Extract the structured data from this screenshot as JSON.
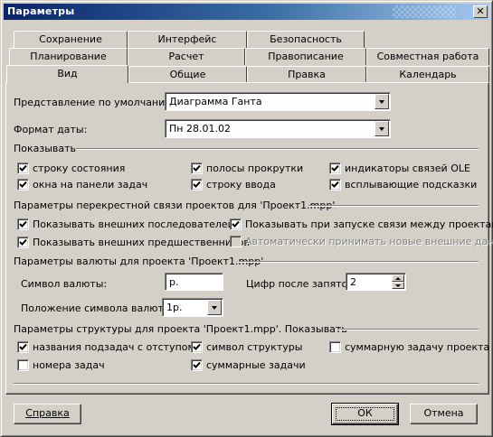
{
  "window": {
    "title": "Параметры",
    "close_glyph": "✕"
  },
  "tabs": {
    "row1": [
      "Сохранение",
      "Интерфейс",
      "Безопасность"
    ],
    "row2": [
      "Планирование",
      "Расчет",
      "Правописание",
      "Совместная работа"
    ],
    "row3": [
      "Вид",
      "Общие",
      "Правка",
      "Календарь"
    ],
    "active": "Вид"
  },
  "view": {
    "default_view_label": "Представление по умолчанию:",
    "default_view_value": "Диаграмма Ганта",
    "date_format_label": "Формат даты:",
    "date_format_value": "Пн 28.01.02"
  },
  "show": {
    "title": "Показывать",
    "items": [
      {
        "label": "строку состояния",
        "checked": true
      },
      {
        "label": "окна на панели задач",
        "checked": true
      },
      {
        "label": "полосы прокрутки",
        "checked": true
      },
      {
        "label": "строку ввода",
        "checked": true
      },
      {
        "label": "индикаторы связей OLE",
        "checked": true
      },
      {
        "label": "всплывающие подсказки",
        "checked": true
      }
    ]
  },
  "crosslink": {
    "title": "Параметры перекрестной связи проектов для 'Проект1.mpp'",
    "items": [
      {
        "label": "Показывать внешних последователей",
        "checked": true,
        "enabled": true
      },
      {
        "label": "Показывать внешних предшественников",
        "checked": true,
        "enabled": true
      },
      {
        "label": "Показывать при запуске связи между проектами",
        "checked": true,
        "enabled": true
      },
      {
        "label": "Автоматически принимать новые внешние данные",
        "checked": false,
        "enabled": false
      }
    ]
  },
  "currency": {
    "title": "Параметры валюты для проекта 'Проект1.mpp'",
    "symbol_label": "Символ валюты:",
    "symbol_value": "р.",
    "decimals_label": "Цифр после запятой:",
    "decimals_value": "2",
    "placement_label": "Положение символа валюты:",
    "placement_value": "1р."
  },
  "outline": {
    "title": "Параметры структуры для проекта 'Проект1.mpp'. Показывать",
    "items": [
      {
        "label": "названия подзадач с отступом",
        "checked": true
      },
      {
        "label": "номера задач",
        "checked": false
      },
      {
        "label": "символ структуры",
        "checked": true
      },
      {
        "label": "суммарные задачи",
        "checked": true
      },
      {
        "label": "суммарную задачу проекта",
        "checked": false
      }
    ]
  },
  "buttons": {
    "help": "Справка",
    "ok": "ОК",
    "cancel": "Отмена"
  }
}
